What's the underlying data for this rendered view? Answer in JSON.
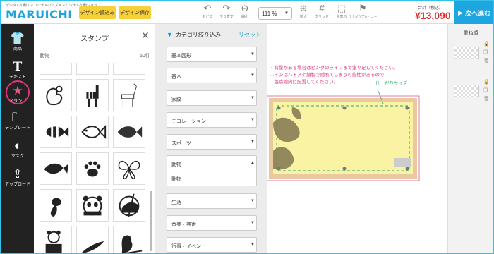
{
  "header": {
    "logo_tagline": "デジタル印刷・オリジナルグッズ＆オリジナル印刷ショップ",
    "logo_name": "MARUICHI",
    "design_load": "デザイン読込み",
    "design_save": "デザイン保存",
    "tools": [
      {
        "icon": "undo-icon",
        "label": "もどる"
      },
      {
        "icon": "redo-icon",
        "label": "やり直す"
      },
      {
        "icon": "zoom-out-icon",
        "label": "縮小"
      },
      {
        "icon": "zoom-in-icon",
        "label": "拡大"
      },
      {
        "icon": "grid-icon",
        "label": "グリッド"
      },
      {
        "icon": "fullscreen-icon",
        "label": "全表示"
      },
      {
        "icon": "preview-icon",
        "label": "仕上がりプレビュー"
      }
    ],
    "zoom": "111 %",
    "total_label": "合計（税込）",
    "total_price": "¥13,090",
    "next_button": "次へ進む"
  },
  "leftbar": [
    {
      "icon": "tshirt-icon",
      "label": "商品"
    },
    {
      "icon": "text-icon",
      "label": "テキスト"
    },
    {
      "icon": "stamp-icon",
      "label": "スタンプ",
      "active": true
    },
    {
      "icon": "folder-icon",
      "label": "テンプレート"
    },
    {
      "icon": "mask-icon",
      "label": "マスク"
    },
    {
      "icon": "upload-icon",
      "label": "アップロード"
    }
  ],
  "stamp_panel": {
    "title": "スタンプ",
    "category": "動物",
    "count": "60件",
    "stamps": [
      "squirrel-icon",
      "zebra-icon",
      "deer-icon",
      "clownfish-icon",
      "fish-outline-icon",
      "fish-silhouette-icon",
      "tropical-fish-icon",
      "paw-icon",
      "butterfly-icon",
      "goldfish-icon",
      "panda-icon",
      "panda-bamboo-icon",
      "panda-sitting-icon",
      "bird-icon",
      "bird-branch-icon"
    ]
  },
  "filter_panel": {
    "title": "カテゴリ絞り込み",
    "reset": "リセット",
    "items": [
      "基本図形",
      "基本",
      "家紋",
      "デコレーション",
      "スポーツ",
      "動物",
      "生活",
      "音楽・芸術",
      "行事・イベント"
    ],
    "expanded_sub": "動物"
  },
  "canvas": {
    "notes": [
      "・背景がある場合はピンクのライ…まで塗り足してください。",
      "…インはハトメや縫製で隠れてしまう可能性があるので",
      "…色点線内に配置してください。"
    ],
    "finish_label": "仕上がりサイズ"
  },
  "rightpanel": {
    "title": "重ね順"
  },
  "colors": {
    "accent": "#1da6df",
    "price": "#e03030",
    "stamp_active": "#e0337a",
    "header_button": "#f7cf36"
  }
}
